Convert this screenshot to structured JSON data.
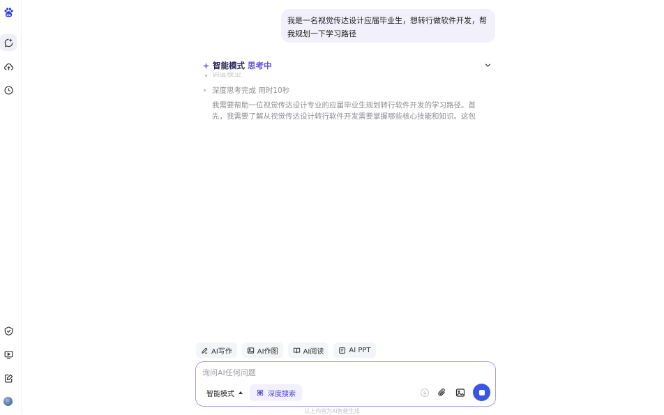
{
  "sidebar": {
    "items": [
      {
        "name": "logo",
        "icon": "baidu-paw-logo"
      },
      {
        "name": "new-chat",
        "icon": "chat-bubble-plus-icon",
        "active": true
      },
      {
        "name": "cloud",
        "icon": "cloud-upload-icon"
      },
      {
        "name": "history",
        "icon": "clock-icon"
      },
      {
        "name": "tasks",
        "icon": "check-shield-icon"
      },
      {
        "name": "media",
        "icon": "screen-play-icon"
      },
      {
        "name": "notes",
        "icon": "edit-doc-icon"
      }
    ]
  },
  "chat": {
    "user_message": "我是一名视觉传达设计应届毕业生，想转行做软件开发，帮我规划一下学习路径",
    "thinking": {
      "mode_label": "智能模式",
      "status_label": "思考中",
      "faded_step": "调度模型",
      "deep_step": "深度思考完成 用时10秒",
      "reasoning_text": "我需要帮助一位视觉传达设计专业的应届毕业生规划转行软件开发的学习路径。首先，我需要了解从视觉传达设计转行软件开发需要掌握哪些核心技能和知识。这包"
    }
  },
  "tools": {
    "chips": [
      {
        "label": "AI写作",
        "icon": "pen-icon"
      },
      {
        "label": "AI作图",
        "icon": "image-icon"
      },
      {
        "label": "AI阅读",
        "icon": "book-icon"
      },
      {
        "label": "AI PPT",
        "icon": "slides-icon"
      }
    ]
  },
  "composer": {
    "placeholder": "询问AI任何问题",
    "mode_select": "智能模式",
    "deep_search_label": "深度搜索"
  },
  "footer": {
    "note": "以上内容为AI智能生成"
  },
  "colors": {
    "accent": "#5b53e6",
    "send": "#3a56e6",
    "bubble": "#f1f0fb",
    "input_border": "#a79bf0"
  }
}
